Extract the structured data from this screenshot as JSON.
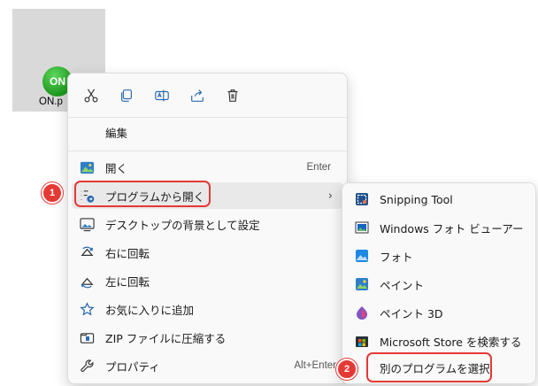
{
  "desktop": {
    "file_name": "ON.p",
    "file_icon_text": "ON"
  },
  "context_menu": {
    "toolbar": [
      {
        "name": "cut-icon"
      },
      {
        "name": "copy-icon"
      },
      {
        "name": "rename-icon"
      },
      {
        "name": "share-icon"
      },
      {
        "name": "delete-icon"
      }
    ],
    "edit_label": "編集",
    "items": [
      {
        "label": "開く",
        "shortcut": "Enter",
        "icon": "photos-icon"
      },
      {
        "label": "プログラムから開く",
        "icon": "open-with-icon",
        "has_submenu": true
      },
      {
        "label": "デスクトップの背景として設定",
        "icon": "wallpaper-icon"
      },
      {
        "label": "右に回転",
        "icon": "rotate-right-icon"
      },
      {
        "label": "左に回転",
        "icon": "rotate-left-icon"
      },
      {
        "label": "お気に入りに追加",
        "icon": "star-icon"
      },
      {
        "label": "ZIP ファイルに圧縮する",
        "icon": "zip-icon"
      },
      {
        "label": "プロパティ",
        "shortcut": "Alt+Enter",
        "icon": "wrench-icon"
      }
    ]
  },
  "submenu": {
    "items": [
      {
        "label": "Snipping Tool",
        "icon": "snipping-tool-icon"
      },
      {
        "label": "Windows フォト ビューアー",
        "icon": "photo-viewer-icon"
      },
      {
        "label": "フォト",
        "icon": "photos-app-icon"
      },
      {
        "label": "ペイント",
        "icon": "paint-icon"
      },
      {
        "label": "ペイント 3D",
        "icon": "paint-3d-icon"
      },
      {
        "label": "Microsoft Store を検索する",
        "icon": "store-icon"
      },
      {
        "label": "別のプログラムを選択",
        "icon": ""
      }
    ]
  },
  "annotations": {
    "step1": "1",
    "step2": "2",
    "color": "#e53935"
  }
}
